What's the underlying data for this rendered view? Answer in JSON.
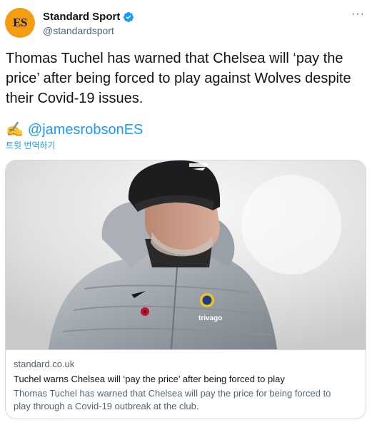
{
  "author": {
    "avatar_text": "ES",
    "display_name": "Standard Sport",
    "handle": "@standardsport",
    "verified": true
  },
  "menu": {
    "more_label": "···"
  },
  "tweet": {
    "text": "Thomas Tuchel has warned that Chelsea will ‘pay the price’ after being forced to play against Wolves despite their Covid-19 issues.",
    "emoji": "✍️",
    "mention": "@jamesrobsonES",
    "translate_label": "트윗 번역하기"
  },
  "card": {
    "image_icon": "photo-of-man-in-beanie-and-puffer-jacket",
    "domain": "standard.co.uk",
    "title": "Tuchel warns Chelsea will ‘pay the price’ after being forced to play",
    "description": "Thomas Tuchel has warned that Chelsea will pay the price for being forced to play through a Covid-19 outbreak at the club."
  },
  "colors": {
    "accent": "#1d9bf0",
    "avatar_bg": "#f29d12",
    "text": "#0f1419",
    "muted": "#536471",
    "border": "#cfd9de"
  }
}
